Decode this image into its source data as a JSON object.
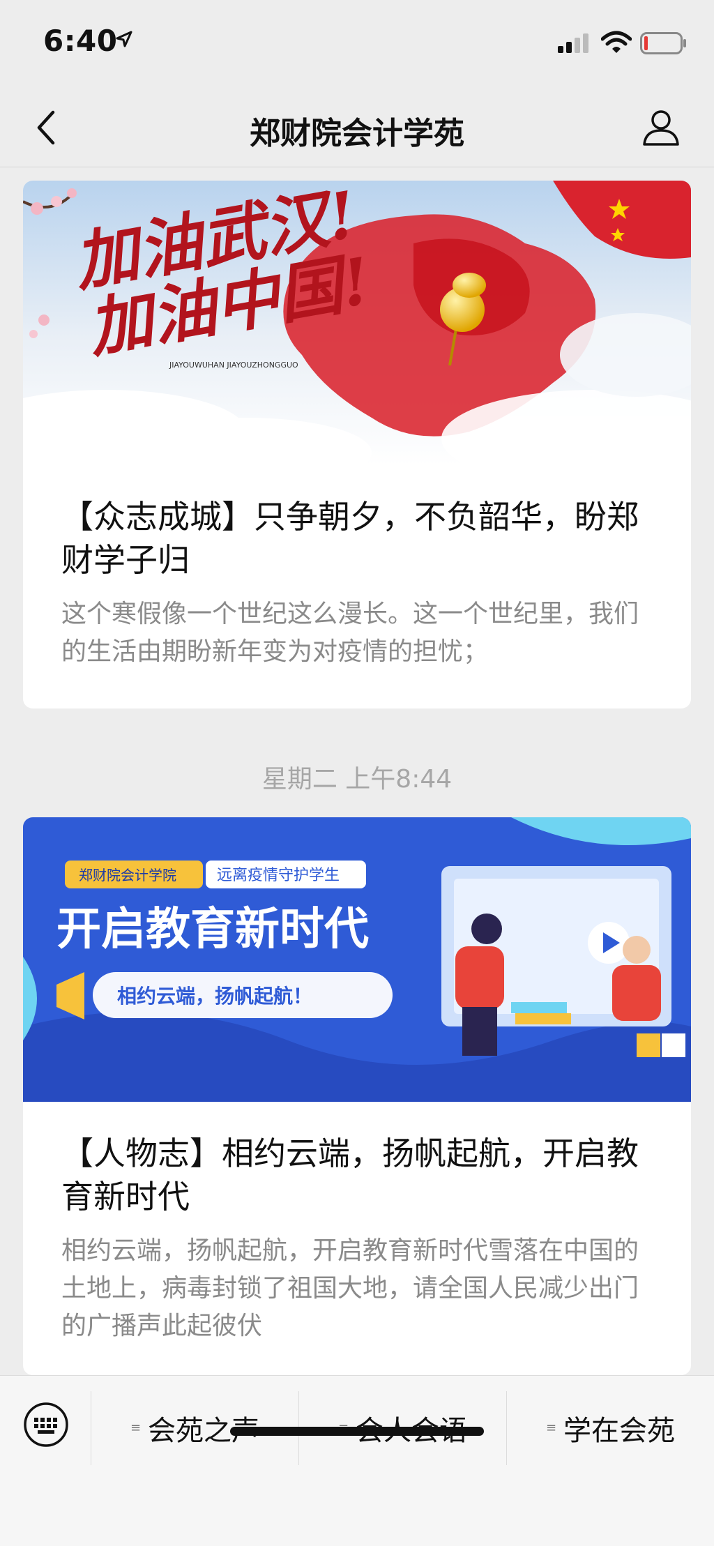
{
  "status": {
    "time": "6:40",
    "icons": [
      "location-arrow-icon",
      "signal-icon",
      "wifi-icon",
      "battery-icon"
    ]
  },
  "nav": {
    "title": "郑财院会计学苑",
    "back_icon": "chevron-left-icon",
    "profile_icon": "person-icon"
  },
  "articles": [
    {
      "banner_text": [
        "加油武汉!",
        "加油中国!"
      ],
      "banner_subtext": "JIAYOUWUHAN JIAYOUZHONGGUO",
      "title": "【众志成城】只争朝夕，不负韶华，盼郑财学子归",
      "desc": "这个寒假像一个世纪这么漫长。这一个世纪里，我们的生活由期盼新年变为对疫情的担忧；"
    },
    {
      "banner_tag1": "郑财院会计学院",
      "banner_tag2": "远离疫情守护学生",
      "banner_headline": "开启教育新时代",
      "banner_slogan": "相约云端，扬帆起航！",
      "title": "【人物志】相约云端，扬帆起航，开启教育新时代",
      "desc": "相约云端，扬帆起航，开启教育新时代雪落在中国的土地上，病毒封锁了祖国大地，请全国人民减少出门的广播声此起彼伏"
    }
  ],
  "timestamp": "星期二 上午8:44",
  "bottom_menu": {
    "keyboard_icon": "keyboard-icon",
    "items": [
      "会苑之声",
      "会人会语",
      "学在会苑"
    ]
  },
  "colors": {
    "background": "#ededed",
    "card": "#ffffff",
    "secondary_text": "#8a8a8a",
    "banner1_red": "#d9232e",
    "banner2_blue": "#2f5bd6"
  }
}
